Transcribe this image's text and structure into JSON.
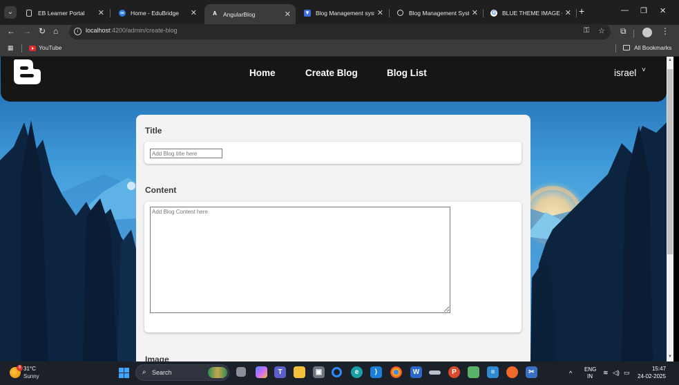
{
  "browser": {
    "tabs": [
      {
        "title": "EB Learner Portal",
        "icon": "document-icon",
        "active": false
      },
      {
        "title": "Home - EduBridge",
        "icon": "edubridge-logo-icon",
        "active": false
      },
      {
        "title": "AngularBlog",
        "icon": "angular-logo-icon",
        "active": true
      },
      {
        "title": "Blog Management system",
        "icon": "blog-icon",
        "active": false
      },
      {
        "title": "Blog Management System",
        "icon": "chatgpt-icon",
        "active": false
      },
      {
        "title": "BLUE THEME IMAGE OG H",
        "icon": "google-icon",
        "active": false
      }
    ],
    "new_tab_glyph": "+",
    "url_host": "localhost",
    "url_path": ":4200/admin/create-blog",
    "bookmarks": [
      {
        "label": "YouTube",
        "icon": "youtube-icon"
      }
    ],
    "all_bookmarks_label": "All Bookmarks"
  },
  "app": {
    "nav": {
      "logo": "blogger-logo-icon",
      "links": [
        "Home",
        "Create Blog",
        "Blog List"
      ],
      "user": "israel",
      "caret": "˅"
    },
    "form": {
      "title_label": "Title",
      "title_placeholder": "Add Blog title here",
      "content_label": "Content",
      "content_placeholder": "Add Blog Content here",
      "image_label": "Image"
    }
  },
  "taskbar": {
    "weather_temp": "31°C",
    "weather_cond": "Sunny",
    "weather_badge": "8",
    "search_label": "Search",
    "lang_top": "ENG",
    "lang_bottom": "IN",
    "time": "15:47",
    "date": "24-02-2025",
    "apps": [
      "file-icon",
      "copilot-icon",
      "teams-icon",
      "explorer-icon",
      "store-icon",
      "opera-icon",
      "edge-icon",
      "vscode-icon",
      "chrome-icon",
      "word-icon",
      "edit-icon",
      "pdf-icon",
      "notepad-icon",
      "notes-icon",
      "brave-icon",
      "snipping-icon"
    ]
  },
  "colors": {
    "nav_bg": "#161616",
    "card_bg": "#f3f3f3",
    "sky_top": "#1a5fa8",
    "sky_mid": "#4fb0e8",
    "forest": "#0d2440"
  }
}
